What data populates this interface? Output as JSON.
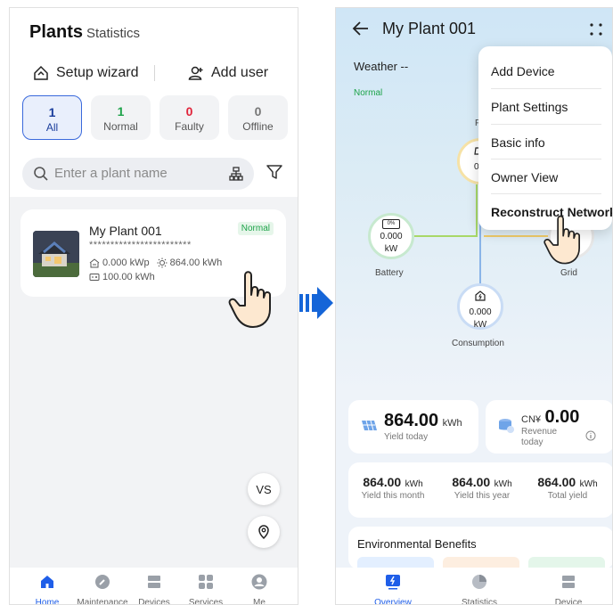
{
  "left": {
    "header": {
      "title": "Plants",
      "tab2": "Statistics"
    },
    "actions": {
      "setup_wizard": "Setup wizard",
      "add_user": "Add user"
    },
    "filters": [
      {
        "num": "1",
        "label": "All",
        "color": "#1a3d9c"
      },
      {
        "num": "1",
        "label": "Normal",
        "color": "#1ea34a"
      },
      {
        "num": "0",
        "label": "Faulty",
        "color": "#e0243a"
      },
      {
        "num": "0",
        "label": "Offline",
        "color": "#777777"
      }
    ],
    "search": {
      "placeholder": "Enter a plant name"
    },
    "plant": {
      "name": "My Plant 001",
      "address": "************************",
      "capacity": "0.000 kWp",
      "energy": "864.00 kWh",
      "storage": "100.00 kWh",
      "status": "Normal"
    },
    "fab_vs": "VS",
    "nav": [
      "Home",
      "Maintenance",
      "Devices",
      "Services",
      "Me"
    ]
  },
  "right": {
    "title": "My Plant 001",
    "weather": "Weather --",
    "status": "Normal",
    "nodes": {
      "battery": {
        "label": "Battery",
        "value": "0.000",
        "unit": "kW",
        "soc": "0%"
      },
      "consumption": {
        "label": "Consumption",
        "value": "0.000",
        "unit": "kW"
      },
      "pv": {
        "label": "P",
        "value": "0.0",
        "unit": "k"
      },
      "grid": {
        "label": "Grid",
        "value": "0"
      }
    },
    "menu": [
      "Add Device",
      "Plant Settings",
      "Basic info",
      "Owner View",
      "Reconstruct Network"
    ],
    "yield_today": {
      "value": "864.00",
      "unit": "kWh",
      "label": "Yield today"
    },
    "revenue": {
      "currency": "CN¥",
      "value": "0.00",
      "label1": "Revenue",
      "label2": "today"
    },
    "totals": [
      {
        "value": "864.00",
        "unit": "kWh",
        "label": "Yield this month"
      },
      {
        "value": "864.00",
        "unit": "kWh",
        "label": "Yield this year"
      },
      {
        "value": "864.00",
        "unit": "kWh",
        "label": "Total yield"
      }
    ],
    "env_title": "Environmental Benefits",
    "nav": [
      "Overview",
      "Statistics",
      "Device"
    ]
  },
  "colors": {
    "accent": "#1f5ee8",
    "normal": "#1ea34a",
    "faulty": "#e0243a",
    "arrow": "#1565d8"
  }
}
